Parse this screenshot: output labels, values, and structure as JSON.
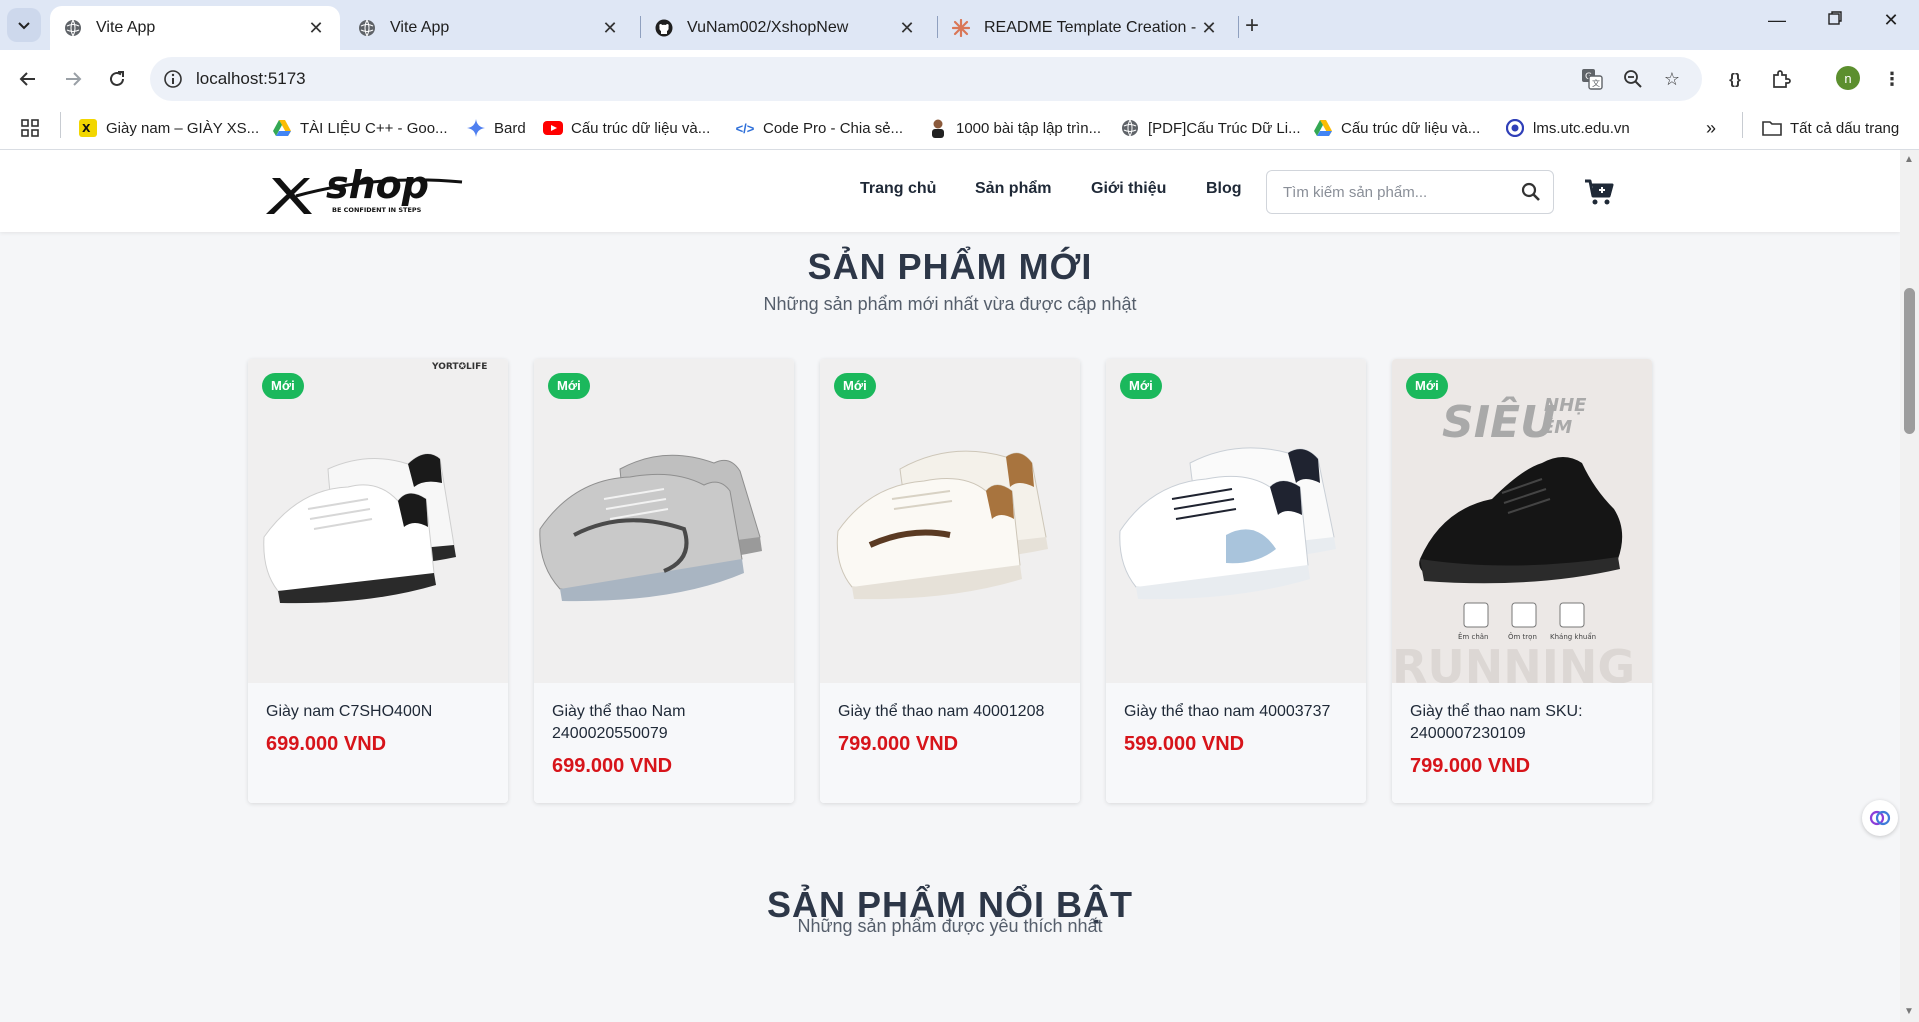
{
  "browser": {
    "tabs": [
      {
        "title": "Vite App",
        "active": true,
        "icon": "globe-icon"
      },
      {
        "title": "Vite App",
        "active": false,
        "icon": "globe-icon"
      },
      {
        "title": "VuNam002/XshopNew",
        "active": false,
        "icon": "github-icon"
      },
      {
        "title": "README Template Creation - Cl",
        "active": false,
        "icon": "claude-icon"
      }
    ],
    "url": "localhost:5173",
    "profile_initial": "n",
    "bookmarks": [
      {
        "label": "Giày nam – GIÀY XS...",
        "icon": "xshop-icon"
      },
      {
        "label": "TÀI LIỆU C++ - Goo...",
        "icon": "drive-icon"
      },
      {
        "label": "Bard",
        "icon": "bard-icon"
      },
      {
        "label": "Cấu trúc dữ liệu và...",
        "icon": "youtube-icon"
      },
      {
        "label": "Code Pro - Chia sẻ...",
        "icon": "code-icon"
      },
      {
        "label": "1000 bài tập lập trìn...",
        "icon": "person-icon"
      },
      {
        "label": "[PDF]Cấu Trúc Dữ Li...",
        "icon": "globe-icon"
      },
      {
        "label": "Cấu trúc dữ liệu và...",
        "icon": "drive-icon"
      },
      {
        "label": "lms.utc.edu.vn",
        "icon": "lms-icon"
      }
    ],
    "all_bookmarks": "Tất cả dấu trang"
  },
  "site": {
    "logo_tagline": "BE CONFIDENT IN STEPS",
    "logo_text": "shop",
    "nav": [
      "Trang chủ",
      "Sản phẩm",
      "Giới thiệu",
      "Blog"
    ],
    "search_placeholder": "Tìm kiếm sản phẩm..."
  },
  "new_section": {
    "title": "SẢN PHẨM MỚI",
    "subtitle": "Những sản phẩm mới nhất vừa được cập nhật"
  },
  "products": [
    {
      "badge": "Mới",
      "name": "Giày nam C7SHO400N",
      "price": "699.000 VND",
      "shoe_color": "white-black",
      "brand_mark": "YORT✪LIFE"
    },
    {
      "badge": "Mới",
      "name": "Giày thể thao Nam 2400020550079",
      "price": "699.000 VND",
      "shoe_color": "grey"
    },
    {
      "badge": "Mới",
      "name": "Giày thể thao nam 40001208",
      "price": "799.000 VND",
      "shoe_color": "cream-brown"
    },
    {
      "badge": "Mới",
      "name": "Giày thể thao nam 40003737",
      "price": "599.000 VND",
      "shoe_color": "white-blue"
    },
    {
      "badge": "Mới",
      "name": "Giày thể thao nam SKU: 2400007230109",
      "price": "799.000 VND",
      "shoe_color": "black",
      "promo": {
        "big": "SIÊU",
        "small1": "NHẸ",
        "small2": "ÊM",
        "features": [
          "Êm chân",
          "Ôm trọn",
          "Kháng khuẩn"
        ],
        "bottom": "RUNNING"
      }
    }
  ],
  "featured_section": {
    "title": "SẢN PHẨM NỔI BẬT",
    "subtitle": "Những sản phẩm được yêu thích nhất"
  },
  "colors": {
    "badge": "#1bb85c",
    "price": "#d7141a",
    "heading": "#2d3748"
  }
}
